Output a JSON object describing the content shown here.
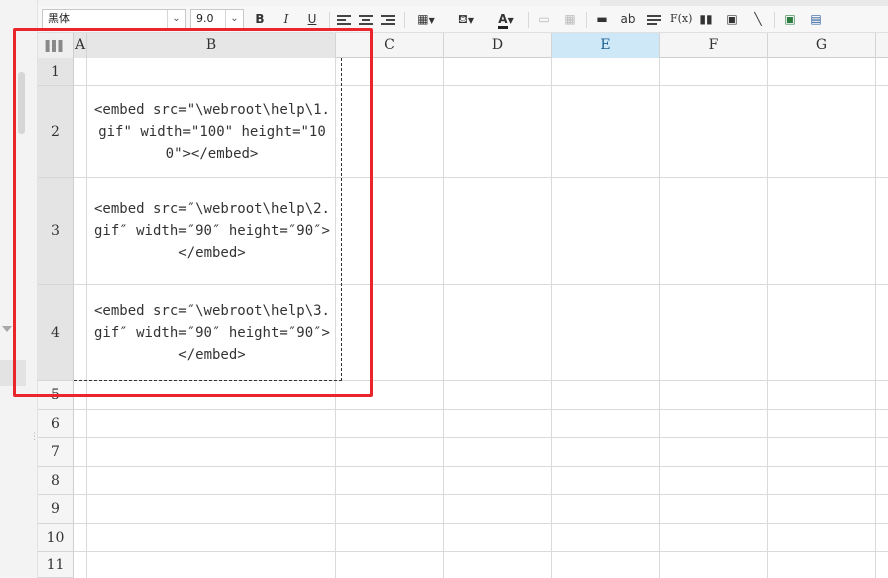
{
  "toolbar": {
    "font_name": "黑体",
    "font_size": "9.0",
    "bold": "B",
    "italic": "I",
    "underline": "U",
    "text_color_letter": "A",
    "strike_label": "ab",
    "formula_label": "F(x)"
  },
  "sheet": {
    "columns": [
      "A",
      "B",
      "C",
      "D",
      "E",
      "F",
      "G"
    ],
    "selected_column": "E",
    "rows": [
      "1",
      "2",
      "3",
      "4",
      "5",
      "6",
      "7",
      "8",
      "9",
      "10",
      "11"
    ],
    "cells": {
      "B2": "<embed src=\"\\webroot\\help\\1.gif\" width=\"100\" height=\"100\"></embed>",
      "B3": "<embed src=″\\webroot\\help\\2.gif″ width=″90″ height=″90″></embed>",
      "B4": "<embed src=″\\webroot\\help\\3.gif″ width=″90″ height=″90″></embed>"
    }
  },
  "colors": {
    "highlight_border": "#e8262b",
    "selected_column_header": "#cfe8f8"
  }
}
